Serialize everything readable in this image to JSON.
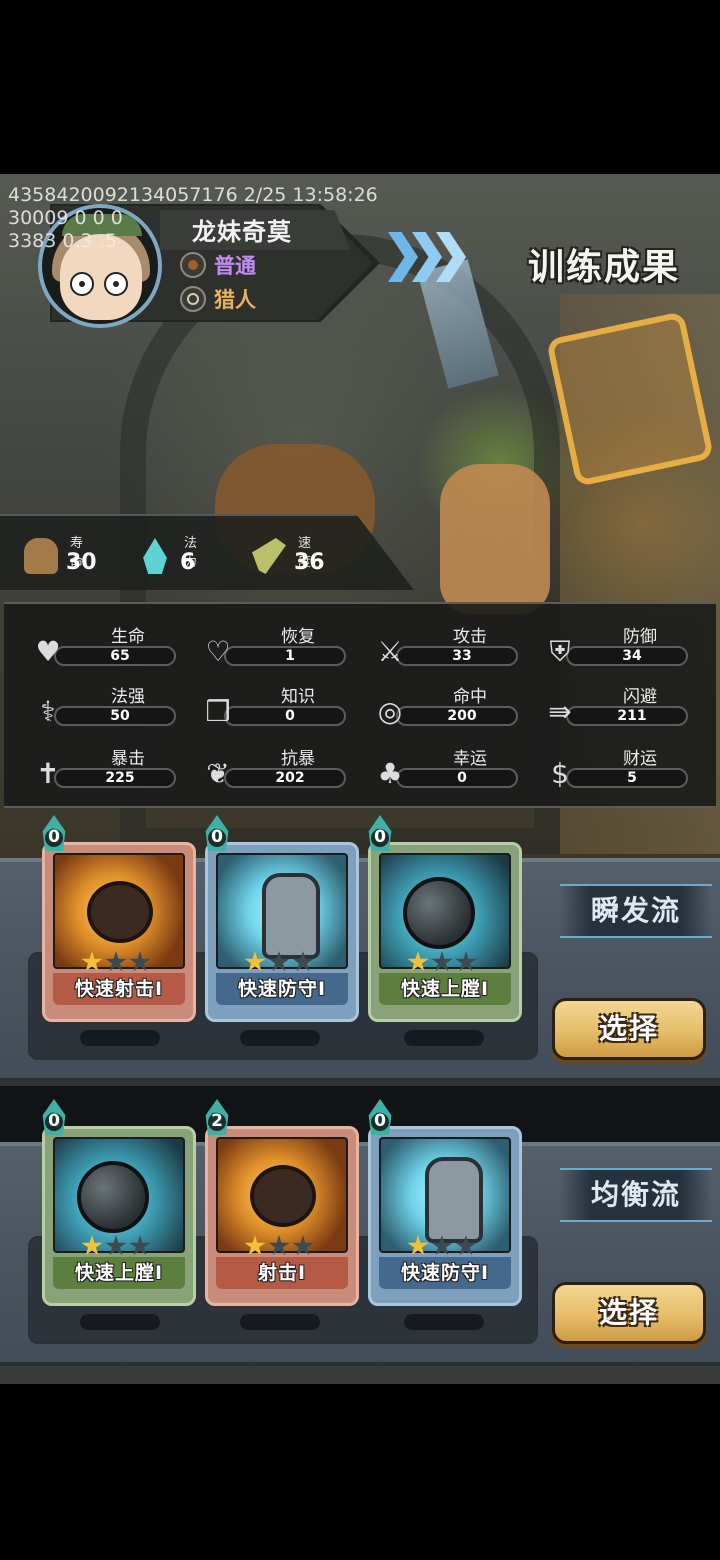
{
  "debug": {
    "line1": "4358420092134057176 2/25 13:58:26",
    "line2": "30009 0 0 0",
    "line3": "3383 0.3 .5"
  },
  "hero": {
    "name": "龙妹奇莫",
    "rarity": "普通",
    "class": "猎人",
    "rarity_color": "#c38df0",
    "class_color": "#e8b35a"
  },
  "header": {
    "title": "训练成果"
  },
  "basic_stats": [
    {
      "label": "寿命",
      "value": "30",
      "icon": "life-icon"
    },
    {
      "label": "法力",
      "value": "6",
      "icon": "mana-icon"
    },
    {
      "label": "速度",
      "value": "36",
      "icon": "speed-icon"
    }
  ],
  "attributes": [
    {
      "label": "生命",
      "value": "65",
      "icon": "heart-icon"
    },
    {
      "label": "恢复",
      "value": "1",
      "icon": "heart-plus-icon"
    },
    {
      "label": "攻击",
      "value": "33",
      "icon": "sword-icon"
    },
    {
      "label": "防御",
      "value": "34",
      "icon": "armor-icon"
    },
    {
      "label": "法强",
      "value": "50",
      "icon": "staff-icon"
    },
    {
      "label": "知识",
      "value": "0",
      "icon": "book-icon"
    },
    {
      "label": "命中",
      "value": "200",
      "icon": "target-icon"
    },
    {
      "label": "闪避",
      "value": "211",
      "icon": "dodge-arrows-icon"
    },
    {
      "label": "暴击",
      "value": "225",
      "icon": "crit-icon"
    },
    {
      "label": "抗暴",
      "value": "202",
      "icon": "resist-crit-icon"
    },
    {
      "label": "幸运",
      "value": "0",
      "icon": "clover-icon"
    },
    {
      "label": "财运",
      "value": "5",
      "icon": "coin-icon"
    }
  ],
  "builds": [
    {
      "style": "瞬发流",
      "select_label": "选择",
      "cards": [
        {
          "name": "快速射击I",
          "cost": "0",
          "stars": 1,
          "max_stars": 3,
          "frame": "red",
          "art": "rock"
        },
        {
          "name": "快速防守I",
          "cost": "0",
          "stars": 1,
          "max_stars": 3,
          "frame": "blue",
          "art": "fist"
        },
        {
          "name": "快速上膛I",
          "cost": "0",
          "stars": 1,
          "max_stars": 3,
          "frame": "green",
          "art": "ball"
        }
      ]
    },
    {
      "style": "均衡流",
      "select_label": "选择",
      "cards": [
        {
          "name": "快速上膛I",
          "cost": "0",
          "stars": 1,
          "max_stars": 3,
          "frame": "green",
          "art": "ball"
        },
        {
          "name": "射击I",
          "cost": "2",
          "stars": 1,
          "max_stars": 3,
          "frame": "red",
          "art": "rock"
        },
        {
          "name": "快速防守I",
          "cost": "0",
          "stars": 1,
          "max_stars": 3,
          "frame": "blue",
          "art": "fist"
        }
      ]
    }
  ]
}
